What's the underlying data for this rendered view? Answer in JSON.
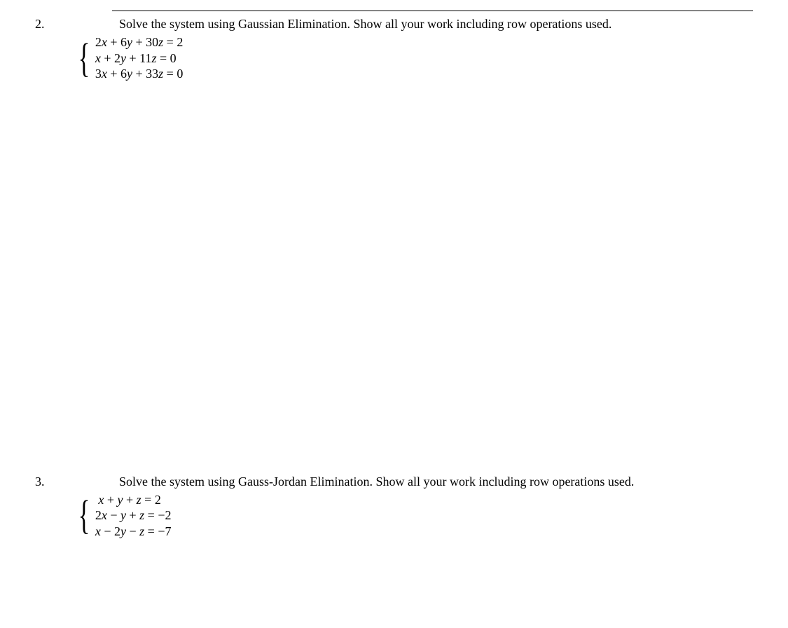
{
  "problems": [
    {
      "number": "2.",
      "instruction": "Solve the system using Gaussian Elimination.  Show all your work including row operations used.",
      "equations": [
        "2x + 6y + 30z = 2",
        "x + 2y + 11z = 0",
        "3x + 6y + 33z = 0"
      ]
    },
    {
      "number": "3.",
      "instruction": "Solve the system using Gauss-Jordan Elimination.  Show all your work including row operations used.",
      "equations": [
        "x + y + z = 2",
        "2x − y + z = −2",
        "x − 2y − z = −7"
      ]
    }
  ]
}
